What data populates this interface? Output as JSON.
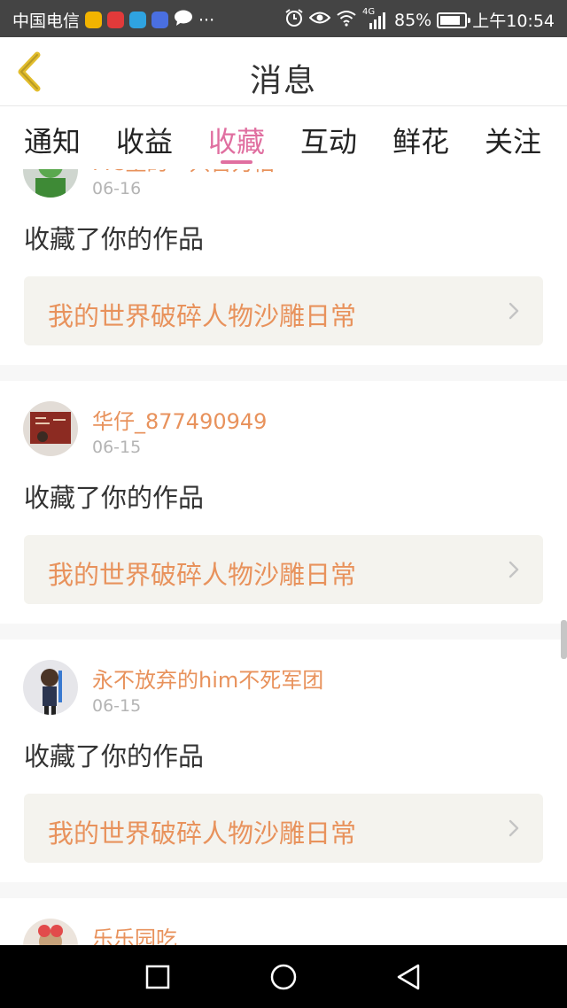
{
  "status_bar": {
    "carrier": "中国电信",
    "more": "···",
    "network": "4G",
    "battery_percent": "85%",
    "battery_level": 0.85,
    "time": "上午10:54",
    "icons": [
      "wechat-app-icon",
      "video-app-icon",
      "telegram-icon",
      "music-app-icon",
      "chat-bubble-icon",
      "alarm-icon",
      "eye-icon",
      "wifi-icon",
      "signal-icon",
      "battery-icon"
    ]
  },
  "header": {
    "title": "消息",
    "back_icon": "back-chevron-icon"
  },
  "tabs": [
    {
      "label": "通知",
      "active": false
    },
    {
      "label": "收益",
      "active": false
    },
    {
      "label": "收藏",
      "active": true
    },
    {
      "label": "互动",
      "active": false
    },
    {
      "label": "鲜花",
      "active": false
    },
    {
      "label": "关注",
      "active": false
    }
  ],
  "colors": {
    "accent": "#e06fa0",
    "link": "#e8925c",
    "status_bar": "#444444",
    "card_link_bg": "#f4f3ee"
  },
  "feed": [
    {
      "username": "MC里的一只苦力怕",
      "date": "06-16",
      "action": "收藏了你的作品",
      "work_title": "我的世界破碎人物沙雕日常"
    },
    {
      "username": "华仔_877490949",
      "date": "06-15",
      "action": "收藏了你的作品",
      "work_title": "我的世界破碎人物沙雕日常"
    },
    {
      "username": "永不放弃的him不死军团",
      "date": "06-15",
      "action": "收藏了你的作品",
      "work_title": "我的世界破碎人物沙雕日常"
    },
    {
      "username": "乐乐园吃",
      "date": "",
      "action": "",
      "work_title": ""
    }
  ],
  "navbar": {
    "icons": [
      "recent-apps-icon",
      "home-icon",
      "back-triangle-icon"
    ]
  }
}
